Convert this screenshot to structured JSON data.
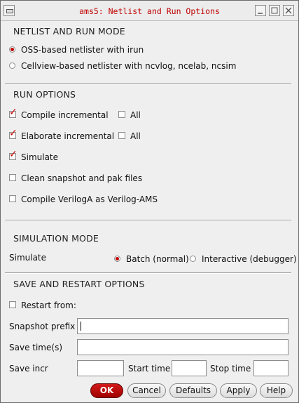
{
  "window": {
    "title": "ams5: Netlist and Run Options"
  },
  "netlist_mode": {
    "heading": "NETLIST AND RUN MODE",
    "options": [
      {
        "label": "OSS-based netlister with irun",
        "selected": true
      },
      {
        "label": "Cellview-based netlister with ncvlog, ncelab, ncsim",
        "selected": false
      }
    ]
  },
  "run_options": {
    "heading": "RUN OPTIONS",
    "compile_incremental": {
      "label": "Compile incremental",
      "checked": true
    },
    "compile_all": {
      "label": "All",
      "checked": false
    },
    "elaborate_incremental": {
      "label": "Elaborate incremental",
      "checked": true
    },
    "elaborate_all": {
      "label": "All",
      "checked": false
    },
    "simulate": {
      "label": "Simulate",
      "checked": true
    },
    "clean_snapshot": {
      "label": "Clean snapshot and pak files",
      "checked": false
    },
    "compile_veriloga": {
      "label": "Compile VerilogA as Verilog-AMS",
      "checked": false
    }
  },
  "simulation_mode": {
    "heading": "SIMULATION MODE",
    "row_label": "Simulate",
    "batch": {
      "label": "Batch (normal)",
      "selected": true
    },
    "interactive": {
      "label": "Interactive (debugger)",
      "selected": false
    }
  },
  "save_restart": {
    "heading": "SAVE AND RESTART OPTIONS",
    "restart_from": {
      "label": "Restart from:",
      "checked": false
    },
    "snapshot_prefix": {
      "label": "Snapshot prefix",
      "value": ""
    },
    "save_times": {
      "label": "Save time(s)",
      "value": ""
    },
    "save_incr": {
      "label": "Save incr",
      "value": ""
    },
    "start_time": {
      "label": "Start time",
      "value": ""
    },
    "stop_time": {
      "label": "Stop time",
      "value": ""
    }
  },
  "buttons": {
    "ok": "OK",
    "cancel": "Cancel",
    "defaults": "Defaults",
    "apply": "Apply",
    "help": "Help"
  },
  "colors": {
    "accent": "#c00000",
    "title_text": "#c00000",
    "background": "#efefef"
  },
  "icons": [
    "window-menu-icon",
    "minimize-icon",
    "maximize-icon",
    "close-icon"
  ]
}
